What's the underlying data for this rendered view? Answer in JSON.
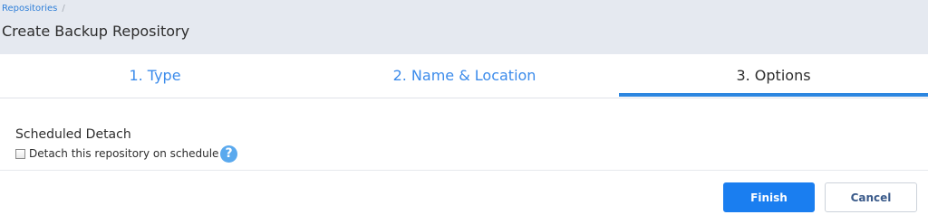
{
  "breadcrumb": {
    "items": [
      "Repositories"
    ],
    "separator": "/"
  },
  "page": {
    "title": "Create Backup Repository"
  },
  "wizard": {
    "tabs": [
      {
        "label": "1. Type",
        "state": "done"
      },
      {
        "label": "2. Name & Location",
        "state": "done"
      },
      {
        "label": "3. Options",
        "state": "active"
      }
    ]
  },
  "options": {
    "section_title": "Scheduled Detach",
    "detach_checkbox_label": "Detach this repository on schedule",
    "detach_checked": false,
    "help_icon_glyph": "?"
  },
  "footer": {
    "finish_label": "Finish",
    "cancel_label": "Cancel"
  },
  "colors": {
    "accent": "#2c86e0",
    "primary_button": "#1a7ef0",
    "header_bg": "#e5e9f0",
    "help_icon": "#5aa9ee"
  }
}
